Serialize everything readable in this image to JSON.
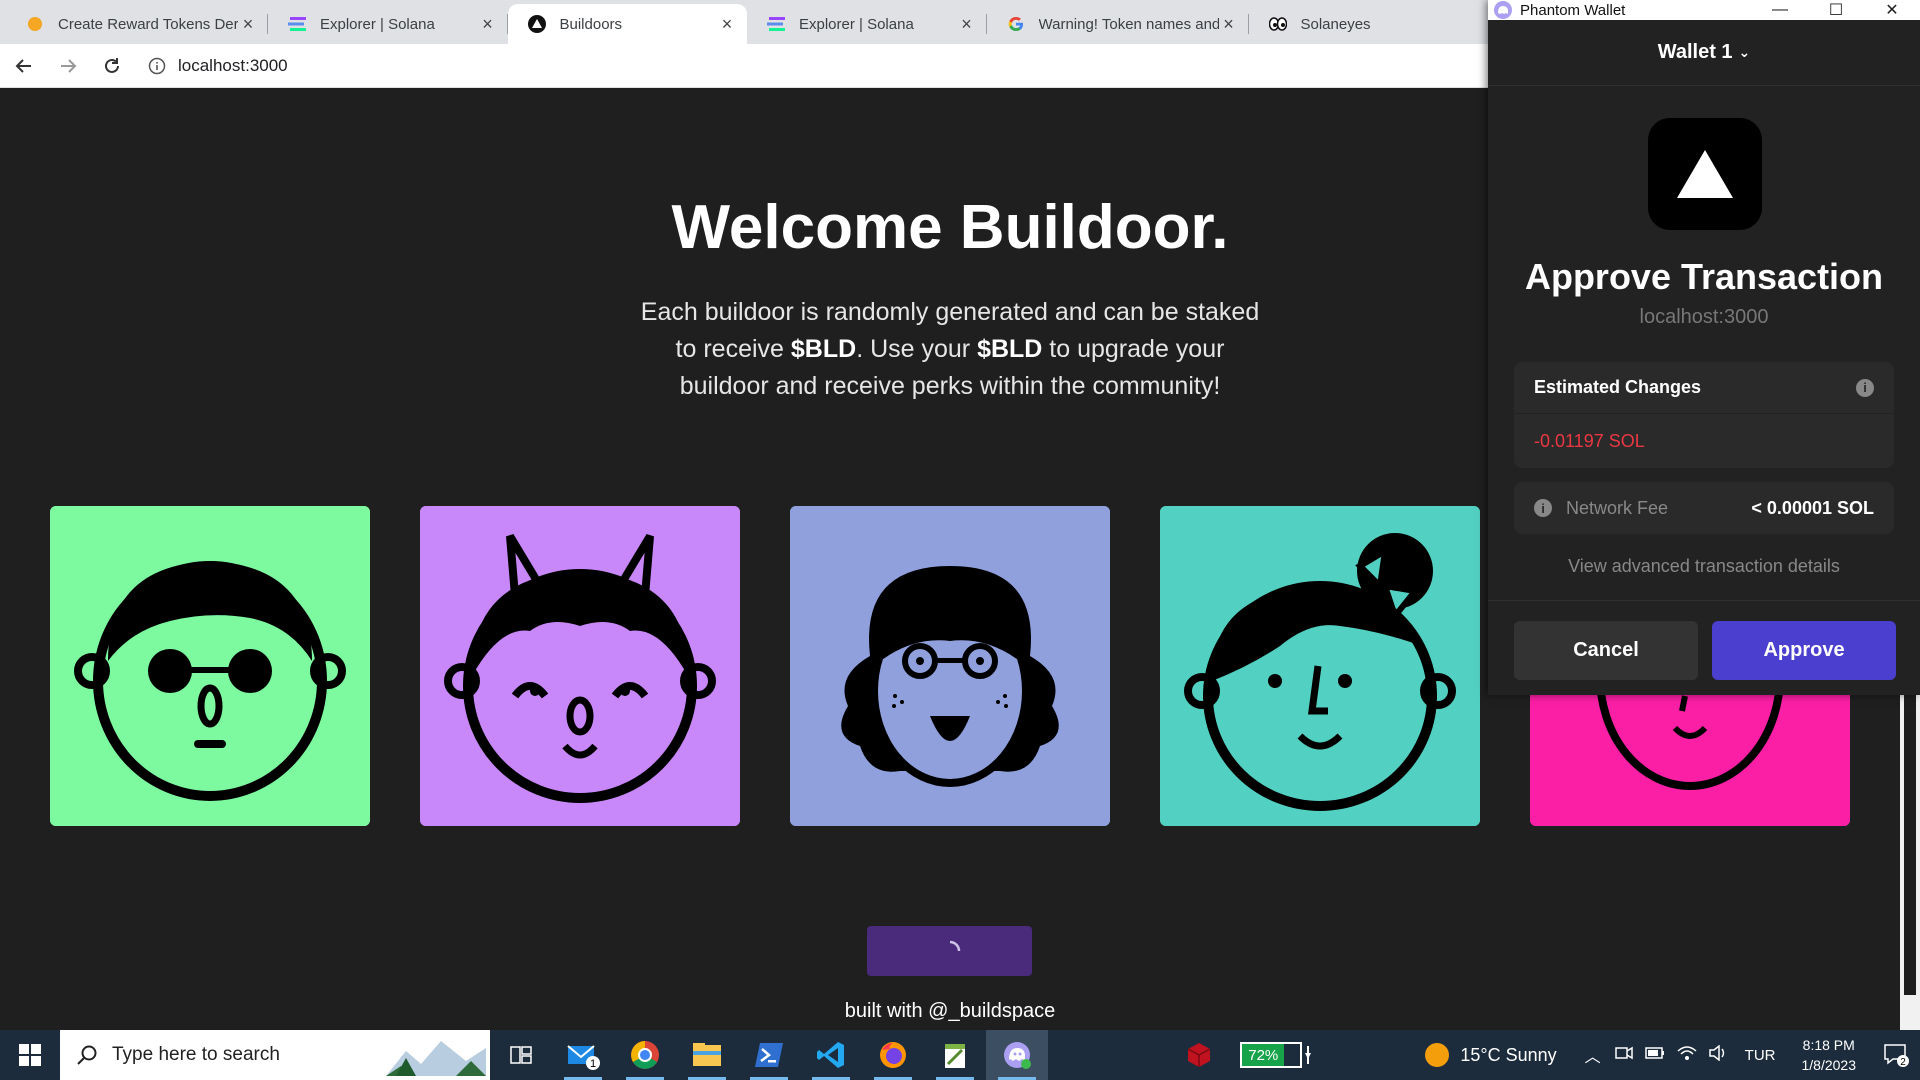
{
  "browser": {
    "tabs": [
      {
        "title": "Create Reward Tokens Ders",
        "icon": "orange-dot-icon"
      },
      {
        "title": "Explorer | Solana",
        "icon": "solana-icon"
      },
      {
        "title": "Buildoors",
        "icon": "buildoors-icon",
        "active": true
      },
      {
        "title": "Explorer | Solana",
        "icon": "solana-icon"
      },
      {
        "title": "Warning! Token names and",
        "icon": "google-icon"
      },
      {
        "title": "Solaneyes",
        "icon": "solaneyes-icon"
      }
    ],
    "close_glyph": "×",
    "url": "localhost:3000"
  },
  "page": {
    "title": "Welcome Buildoor.",
    "desc_part1": "Each buildoor is randomly generated and can be staked to receive ",
    "desc_token1": "$BLD",
    "desc_part2": ". Use your ",
    "desc_token2": "$BLD",
    "desc_part3": " to upgrade your buildoor and receive perks within the community!",
    "cards": [
      {
        "bg": "#7df9a0"
      },
      {
        "bg": "#c988fa"
      },
      {
        "bg": "#8fa0dd"
      },
      {
        "bg": "#52d1c2"
      },
      {
        "bg": "#fb1fa6"
      }
    ],
    "footer": "built with @_buildspace"
  },
  "phantom": {
    "window_title": "Phantom Wallet",
    "wallet_name": "Wallet 1",
    "heading": "Approve Transaction",
    "origin": "localhost:3000",
    "estimated_changes_label": "Estimated Changes",
    "sol_change": "-0.01197 SOL",
    "network_fee_label": "Network Fee",
    "network_fee_value": "< 0.00001 SOL",
    "advanced_link": "View advanced transaction details",
    "cancel": "Cancel",
    "approve": "Approve"
  },
  "taskbar": {
    "search_placeholder": "Type here to search",
    "mail_badge": "1",
    "battery": "72%",
    "weather": "15°C  Sunny",
    "language": "TUR",
    "time": "8:18 PM",
    "date": "1/8/2023",
    "notifications": "2"
  }
}
